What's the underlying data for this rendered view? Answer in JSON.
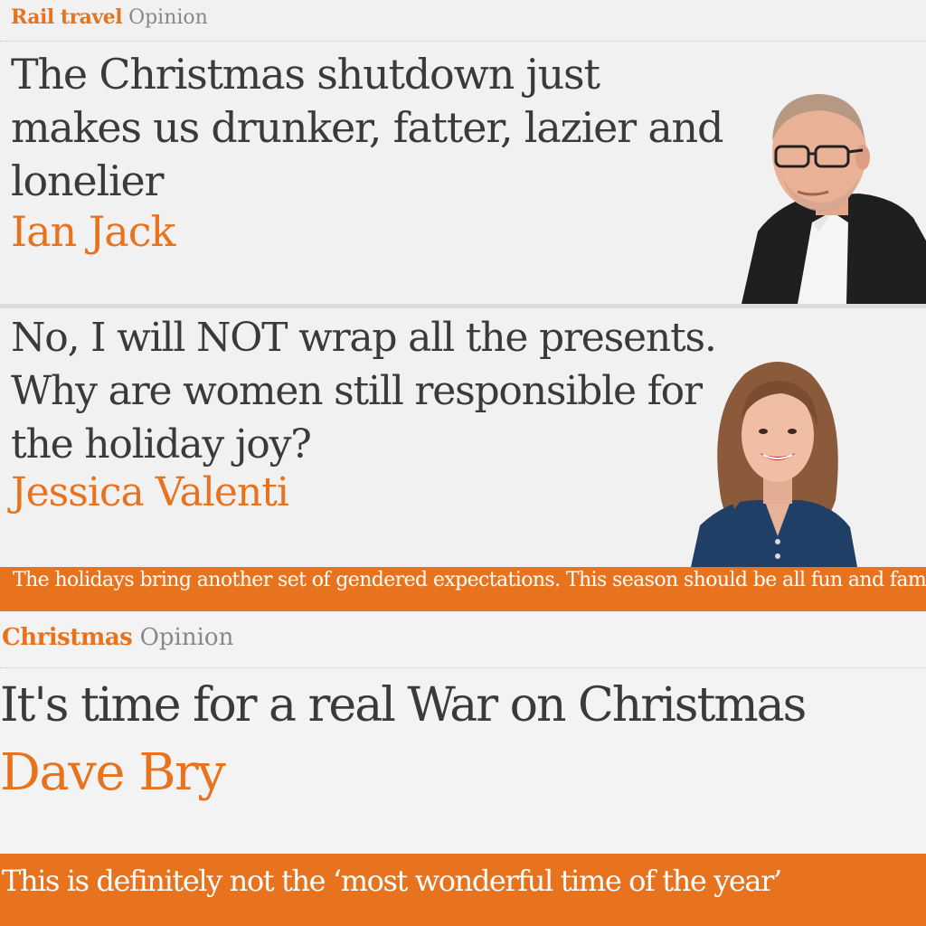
{
  "articles": [
    {
      "kicker": "Rail travel",
      "section": "Opinion",
      "headline_lines": [
        "The Christmas shutdown just",
        "makes us drunker, fatter, lazier and",
        "lonelier"
      ],
      "byline": "Ian Jack",
      "image": "author-portrait-man-glasses"
    },
    {
      "headline_lines": [
        "No, I will NOT wrap all the presents.",
        "Why are women still responsible for",
        "the holiday joy?"
      ],
      "byline": "Jessica Valenti",
      "standfirst": "The holidays bring another set of gendered expectations. This season should be all fun and family not endless more chores and consumerism",
      "image": "author-portrait-woman-smiling"
    },
    {
      "kicker": "Christmas",
      "section": "Opinion",
      "headline": "It's time for a real War on Christmas",
      "byline": "Dave Bry",
      "standfirst": "This is definitely not the ‘most wonderful time of the year’"
    }
  ],
  "colors": {
    "accent": "#e8731e",
    "background": "#f1f1f1",
    "text": "#333333"
  }
}
